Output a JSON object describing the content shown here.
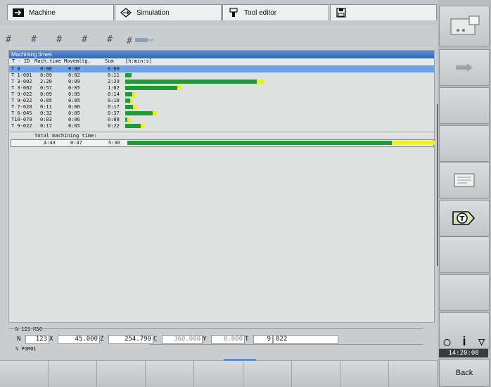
{
  "tabs": [
    {
      "label": "Machine",
      "icon": "arrow-right-icon"
    },
    {
      "label": "Simulation",
      "icon": "diamond-arrows-icon"
    },
    {
      "label": "Tool editor",
      "icon": "tool-holder-icon"
    },
    {
      "label": "",
      "icon": "save-icon"
    }
  ],
  "window": {
    "title": "Machining times"
  },
  "columns": [
    "T - ID",
    "Mach.time",
    "Movemltg.",
    "Sum",
    "[h:min:s]"
  ],
  "rows": [
    {
      "tid": "T 0",
      "mach": "0:00",
      "move": "0:00",
      "sum": "0:00",
      "green": 0.0,
      "yellow": 0.0,
      "selected": true
    },
    {
      "tid": "T 1-001",
      "mach": "0:09",
      "move": "0:02",
      "sum": "0:11",
      "green": 0.02,
      "yellow": 0.0,
      "selected": false
    },
    {
      "tid": "T 3-002",
      "mach": "2:20",
      "move": "0:09",
      "sum": "2:29",
      "green": 0.428,
      "yellow": 0.024,
      "selected": false
    },
    {
      "tid": "T 3-002",
      "mach": "0:57",
      "move": "0:05",
      "sum": "1:02",
      "green": 0.17,
      "yellow": 0.012,
      "selected": false
    },
    {
      "tid": "T 9-022",
      "mach": "0:09",
      "move": "0:05",
      "sum": "0:14",
      "green": 0.023,
      "yellow": 0.012,
      "selected": false
    },
    {
      "tid": "T 9-022",
      "mach": "0:05",
      "move": "0:05",
      "sum": "0:10",
      "green": 0.016,
      "yellow": 0.01,
      "selected": false
    },
    {
      "tid": "T 7-020",
      "mach": "0:11",
      "move": "0:06",
      "sum": "0:17",
      "green": 0.026,
      "yellow": 0.012,
      "selected": false
    },
    {
      "tid": "T 6-045",
      "mach": "0:32",
      "move": "0:05",
      "sum": "0:37",
      "green": 0.09,
      "yellow": 0.012,
      "selected": false
    },
    {
      "tid": "T10-070",
      "mach": "0:03",
      "move": "0:06",
      "sum": "0:08",
      "green": 0.008,
      "yellow": 0.01,
      "selected": false
    },
    {
      "tid": "T 9-022",
      "mach": "0:17",
      "move": "0:05",
      "sum": "0:22",
      "green": 0.05,
      "yellow": 0.012,
      "selected": false
    }
  ],
  "total": {
    "label": "Total machining time:",
    "mach": "4:43",
    "move": "0:47",
    "sum": "5:30",
    "green": 0.86,
    "yellow": 0.14
  },
  "status": {
    "program_line": "N 123 M30",
    "fields": [
      {
        "label": "N",
        "value": "123"
      },
      {
        "label": "X",
        "value": "45.000"
      },
      {
        "label": "Z",
        "value": "254.790"
      },
      {
        "label": "C",
        "value": "360.000"
      },
      {
        "label": "Y",
        "value": "0.000"
      },
      {
        "label": "T",
        "value": "9"
      },
      {
        "label": "",
        "value": "022"
      }
    ],
    "program_name": "% PGM01"
  },
  "clock": "14:20:08",
  "back_label": "Back",
  "info_symbols": {
    "left": "◯",
    "mid": "i",
    "right": "▽"
  }
}
